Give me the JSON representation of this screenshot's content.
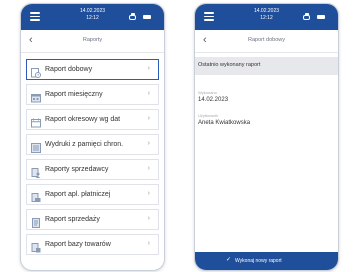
{
  "status": {
    "date": "14.02.2023",
    "time": "12:12"
  },
  "left": {
    "nav_title": "Raporty",
    "items": [
      {
        "label": "Raport dobowy",
        "icon": "clock-report-icon"
      },
      {
        "label": "Raport miesięczny",
        "icon": "calendar-month-icon"
      },
      {
        "label": "Raport okresowy wg dat",
        "icon": "calendar-range-icon"
      },
      {
        "label": "Wydruki z pamięci chron.",
        "icon": "memory-print-icon"
      },
      {
        "label": "Raporty sprzedawcy",
        "icon": "seller-report-icon"
      },
      {
        "label": "Raport apl. płatniczej",
        "icon": "payment-app-icon"
      },
      {
        "label": "Raport sprzedaży",
        "icon": "sales-report-icon"
      },
      {
        "label": "Raport bazy towarów",
        "icon": "goods-base-icon"
      }
    ],
    "selected_index": 0
  },
  "right": {
    "nav_title": "Raport dobowy",
    "section_title": "Ostatnio wykonany raport",
    "executed_label": "Wykonano",
    "executed_value": "14.02.2023",
    "user_label": "Użytkownik",
    "user_value": "Aneta Kwiatkowska",
    "button_label": "Wykonaj nowy raport"
  },
  "colors": {
    "primary": "#1f4e9b",
    "accent": "#2d5bb8",
    "icon": "#8a9bb5"
  }
}
